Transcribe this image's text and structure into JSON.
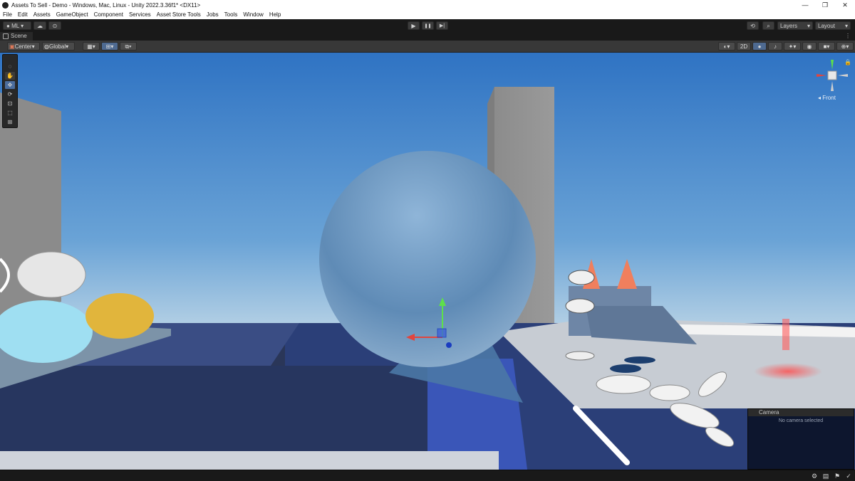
{
  "window": {
    "title": "Assets To Sell - Demo - Windows, Mac, Linux - Unity 2022.3.36f1* <DX11>",
    "controls": {
      "minimize": "—",
      "restore": "❐",
      "close": "✕"
    }
  },
  "menubar": {
    "items": [
      "File",
      "Edit",
      "Assets",
      "GameObject",
      "Component",
      "Services",
      "Asset Store Tools",
      "Jobs",
      "Tools",
      "Window",
      "Help"
    ]
  },
  "toolbar": {
    "account_label": "ML",
    "play_icon": "▶",
    "pause_icon": "❚❚",
    "step_icon": "▶|",
    "layers_label": "Layers",
    "layout_label": "Layout"
  },
  "scene_tab": {
    "label": "Scene"
  },
  "scene_options": {
    "pivot_label": "Center",
    "space_label": "Global",
    "mode_2d_label": "2D"
  },
  "orientation_gizmo": {
    "label": "Front"
  },
  "camera_overlay": {
    "title": "Camera",
    "message": "No camera selected"
  },
  "colors": {
    "sky_top": "#2f73c3",
    "sky_horizon": "#c9dde9",
    "sphere": "#6f9ac1",
    "gizmo_x": "#e2453d",
    "gizmo_y": "#5ee04a",
    "gizmo_z": "#1a3cc0",
    "cone": "#f07f5d"
  }
}
